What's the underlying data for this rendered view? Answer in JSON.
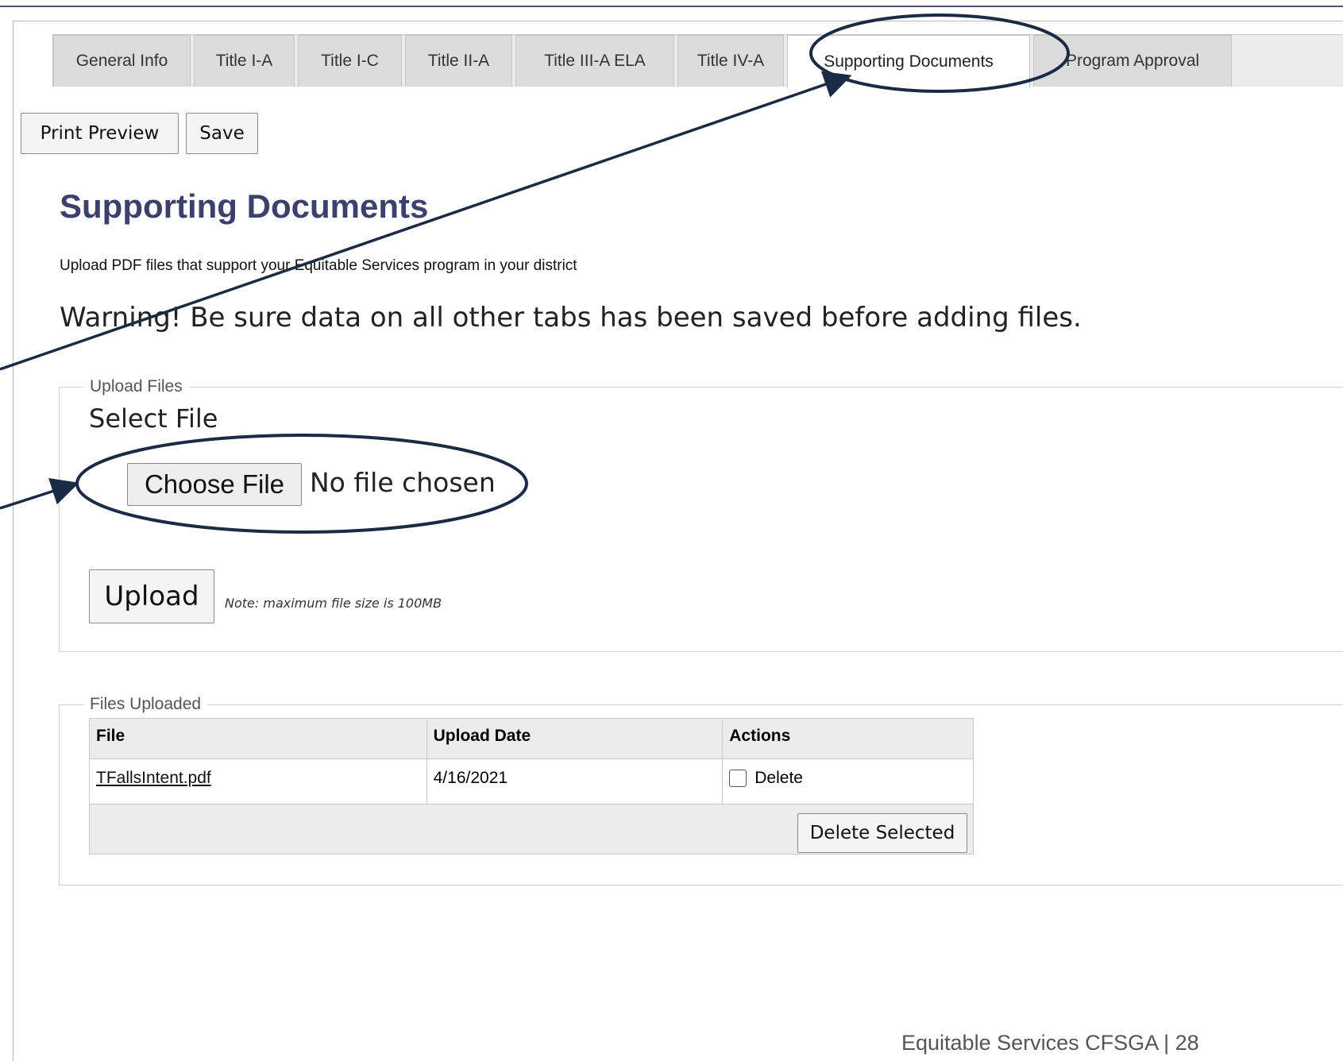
{
  "tabs": [
    {
      "label": "General Info"
    },
    {
      "label": "Title I-A"
    },
    {
      "label": "Title I-C"
    },
    {
      "label": "Title II-A"
    },
    {
      "label": "Title III-A ELA"
    },
    {
      "label": "Title IV-A"
    },
    {
      "label": "Supporting Documents",
      "active": true
    },
    {
      "label": "Program Approval"
    }
  ],
  "toolbar": {
    "print_preview_label": "Print Preview",
    "save_label": "Save"
  },
  "page": {
    "title": "Supporting Documents",
    "subtitle": "Upload PDF files that support your Equitable Services program in your district",
    "warning": "Warning! Be sure data on all other tabs has been saved before adding files."
  },
  "upload": {
    "legend": "Upload Files",
    "select_label": "Select File",
    "choose_file_label": "Choose File",
    "no_file_text": "No file chosen",
    "upload_label": "Upload",
    "note": "Note: maximum file size is 100MB"
  },
  "files": {
    "legend": "Files Uploaded",
    "columns": [
      "File",
      "Upload Date",
      "Actions"
    ],
    "rows": [
      {
        "file": "TFallsIntent.pdf",
        "upload_date": "4/16/2021",
        "action_label": "Delete"
      }
    ],
    "delete_selected_label": "Delete Selected"
  },
  "footer": {
    "text": "Equitable Services CFSGA | 28"
  },
  "colors": {
    "title": "#3d3f6c",
    "annotation": "#1b2b45",
    "tab_bar": "#ececec"
  }
}
